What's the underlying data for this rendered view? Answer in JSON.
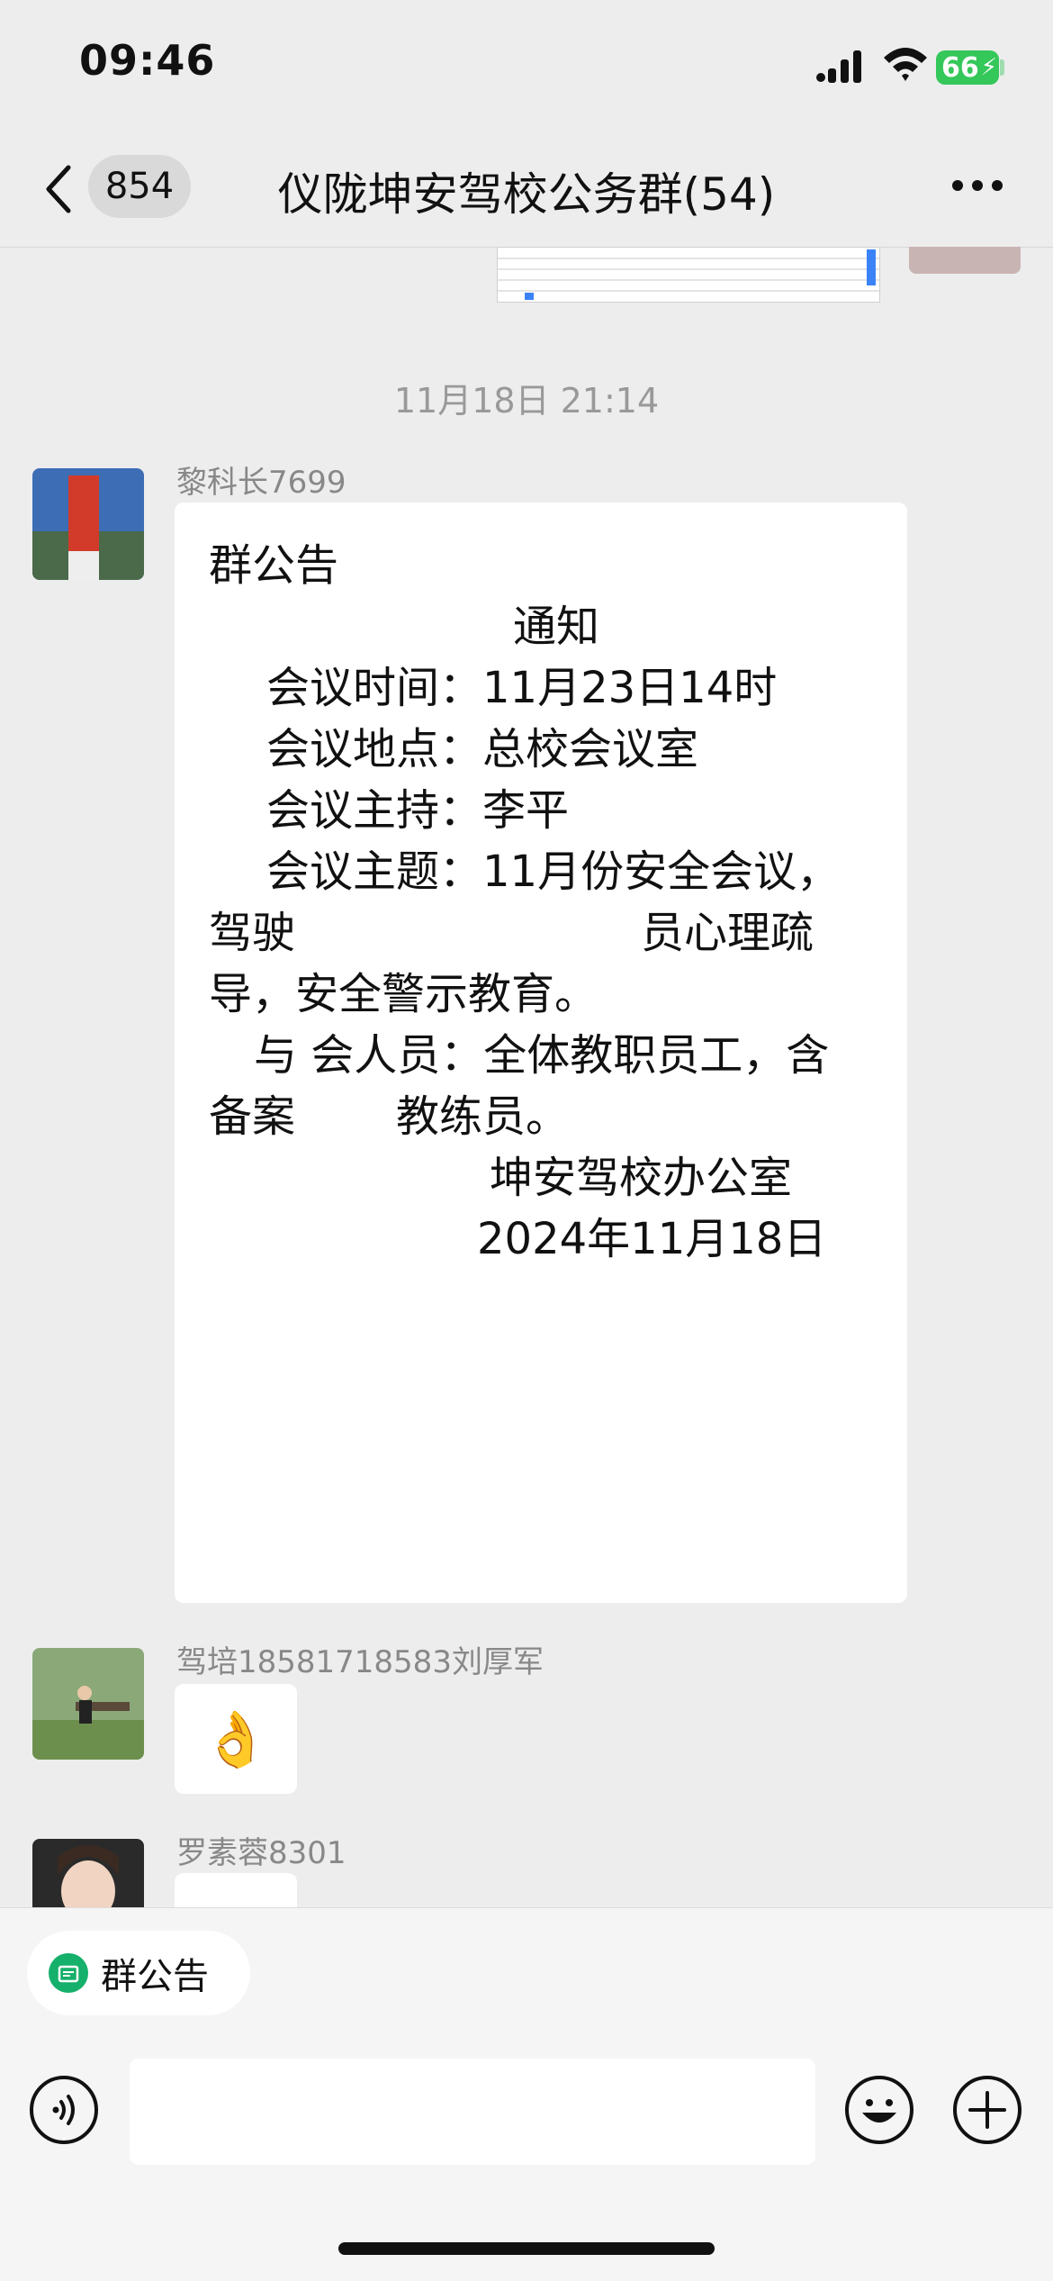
{
  "status_bar": {
    "time": "09:46",
    "battery": "66"
  },
  "nav": {
    "unread_count": "854",
    "title": "仪陇坤安驾校公务群(54)"
  },
  "timestamp": "11月18日 21:14",
  "messages": [
    {
      "sender": "黎科长7699",
      "notice_lines": [
        "群公告",
        "通知",
        "会议时间：11月23日14时",
        "会议地点：总校会议室",
        "会议主持：李平",
        "会议主题：11月份安全会议，",
        "驾驶",
        "员心理疏",
        "导，安全警示教育。",
        "与 会人员：全体教职员工，含",
        "备案",
        "教练员。",
        "坤安驾校办公室",
        "2024年11月18日"
      ]
    },
    {
      "sender": "驾培18581718583刘厚军",
      "content": "👌"
    },
    {
      "sender": "罗素蓉8301"
    }
  ],
  "bottom": {
    "notice_chip": "群公告"
  },
  "colors": {
    "accent_green": "#15b06b",
    "battery_green": "#34c759"
  }
}
